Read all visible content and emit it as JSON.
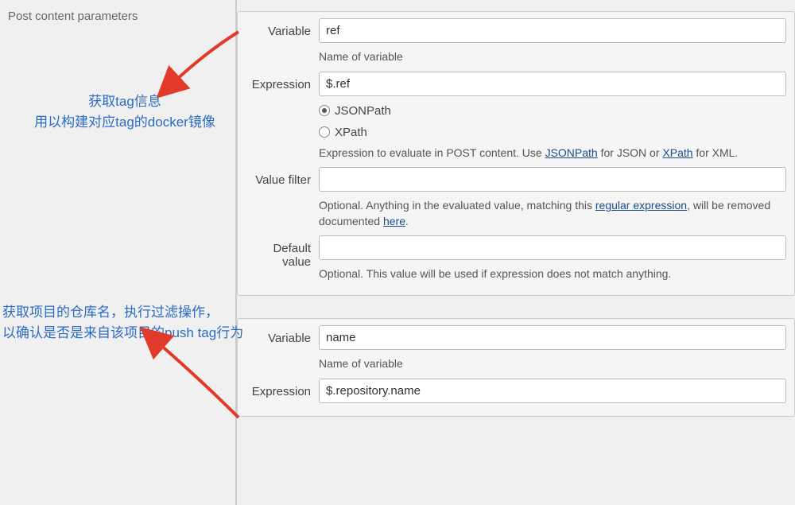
{
  "section_title": "Post content parameters",
  "annotation1_line1": "获取tag信息",
  "annotation1_line2": "用以构建对应tag的docker镜像",
  "annotation2_line1": "获取项目的仓库名，执行过滤操作，",
  "annotation2_line2": "以确认是否是来自该项目的push tag行为",
  "block1": {
    "variable": {
      "label": "Variable",
      "value": "ref",
      "help": "Name of variable"
    },
    "expression": {
      "label": "Expression",
      "value": "$.ref",
      "radio_json": "JSONPath",
      "radio_xpath": "XPath",
      "help_prefix": "Expression to evaluate in POST content. Use ",
      "help_link1": "JSONPath",
      "help_mid": " for JSON or ",
      "help_link2": "XPath",
      "help_suffix": " for XML."
    },
    "valuefilter": {
      "label": "Value filter",
      "value": "",
      "help_prefix": "Optional. Anything in the evaluated value, matching this ",
      "help_link1": "regular expression",
      "help_mid": ", will be removed",
      "help2_prefix": "documented ",
      "help2_link": "here",
      "help2_suffix": "."
    },
    "defaultvalue": {
      "label": "Default value",
      "value": "",
      "help": "Optional. This value will be used if expression does not match anything."
    }
  },
  "block2": {
    "variable": {
      "label": "Variable",
      "value": "name",
      "help": "Name of variable"
    },
    "expression": {
      "label": "Expression",
      "value": "$.repository.name"
    }
  }
}
